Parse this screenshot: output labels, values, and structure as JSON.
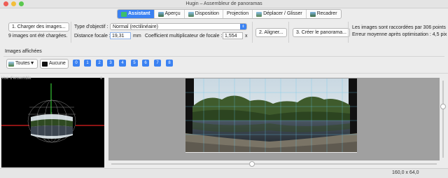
{
  "window": {
    "title": "Hugin – Assembleur de panoramas"
  },
  "tabs": [
    {
      "label": "Assistant",
      "icon": "wizard-icon"
    },
    {
      "label": "Aperçu",
      "icon": "preview-icon"
    },
    {
      "label": "Disposition",
      "icon": "layout-icon"
    },
    {
      "label": "Projection",
      "icon": ""
    },
    {
      "label": "Déplacer / Glisser",
      "icon": "move-icon"
    },
    {
      "label": "Recadrer",
      "icon": "crop-icon"
    }
  ],
  "assistant": {
    "load_button": "1. Charger des images...",
    "images_loaded": "9 images ont été chargées.",
    "lens_type_label": "Type d'objectif :",
    "lens_type_value": "Normal (rectilinéaire)",
    "focal_label": "Distance focale :",
    "focal_value": "19,31",
    "focal_unit": "mm",
    "crop_factor_label": "Coefficient multiplicateur de focale :",
    "crop_factor_value": "1,554",
    "crop_factor_unit": "x",
    "align_button": "2. Aligner...",
    "create_button": "3. Créer le panorama...",
    "status_line1": "Les images sont raccordées par 306 points",
    "status_line2": "Erreur moyenne après optimisation : 4,5 pix"
  },
  "displayed": {
    "label": "Images affichées",
    "all_button": "Toutes▼",
    "none_button": "Aucune",
    "numbers": [
      "0",
      "1",
      "2",
      "3",
      "4",
      "5",
      "6",
      "7",
      "8"
    ]
  },
  "overview": {
    "label": "Vue d'ensemble"
  },
  "status": {
    "dimensions": "160,0 x 64,0"
  },
  "colors": {
    "accent": "#3b82f2",
    "crosshair_green": "#35c435",
    "crosshair_red": "#e02020"
  }
}
